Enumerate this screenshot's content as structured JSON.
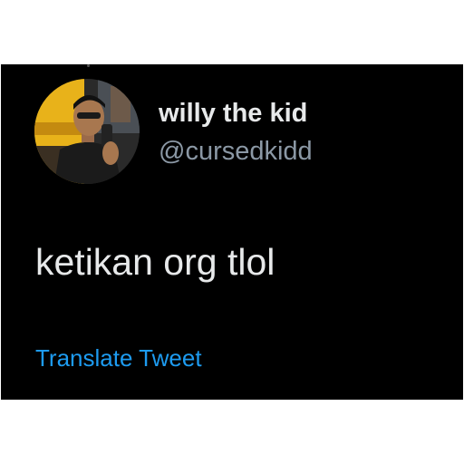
{
  "tweet": {
    "author": {
      "display_name": "willy the kid",
      "handle": "@cursedkidd",
      "avatar_icon": "profile-photo"
    },
    "text": "ketikan org tlol",
    "translate_label": "Translate Tweet"
  },
  "colors": {
    "background": "#000000",
    "primary_text": "#e7e9ea",
    "secondary_text": "#8b98a5",
    "link": "#1d9bf0"
  }
}
